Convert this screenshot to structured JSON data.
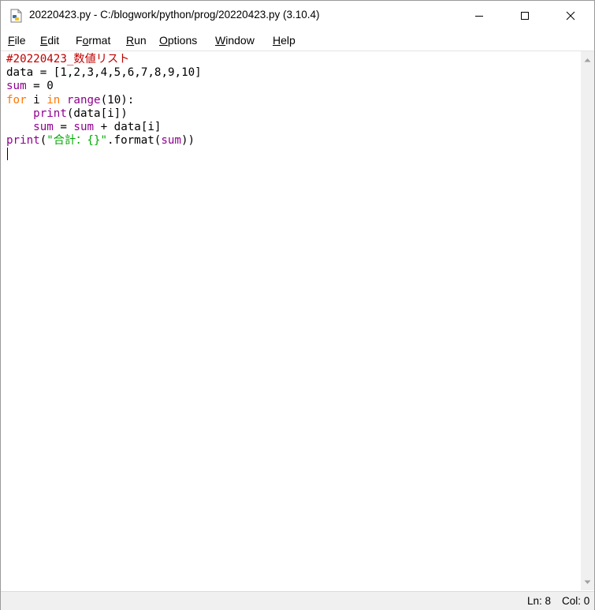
{
  "window": {
    "title": "20220423.py - C:/blogwork/python/prog/20220423.py (3.10.4)"
  },
  "menu": [
    {
      "accel": "F",
      "rest": "ile"
    },
    {
      "accel": "E",
      "rest": "dit"
    },
    {
      "pre": "F",
      "accel": "o",
      "rest": "rmat"
    },
    {
      "accel": "R",
      "rest": "un"
    },
    {
      "accel": "O",
      "rest": "ptions"
    },
    {
      "accel": "W",
      "rest": "indow"
    },
    {
      "accel": "H",
      "rest": "elp"
    }
  ],
  "code": {
    "line1": "#20220423_数値リスト",
    "line2": "data = [1,2,3,4,5,6,7,8,9,10]",
    "line3_var": "sum",
    "line3_rest": " = 0",
    "line4_for": "for",
    "line4_i": " i ",
    "line4_in": "in",
    "line4_sp": " ",
    "line4_range": "range",
    "line4_rest": "(10):",
    "line5_indent": "    ",
    "line5_print": "print",
    "line5_rest": "(data[i])",
    "line6_indent": "    ",
    "line6_sum1": "sum",
    "line6_eq": " = ",
    "line6_sum2": "sum",
    "line6_rest": " + data[i]",
    "line7_print": "print",
    "line7_paren": "(",
    "line7_string": "\"合計：{}\"",
    "line7_format": ".format(",
    "line7_sum": "sum",
    "line7_close": "))"
  },
  "status": {
    "line": "Ln: 8",
    "col": "Col: 0"
  },
  "colors": {
    "comment": "#c00000",
    "builtin": "#900090",
    "keyword": "#ff7700",
    "string": "#00aa00"
  }
}
